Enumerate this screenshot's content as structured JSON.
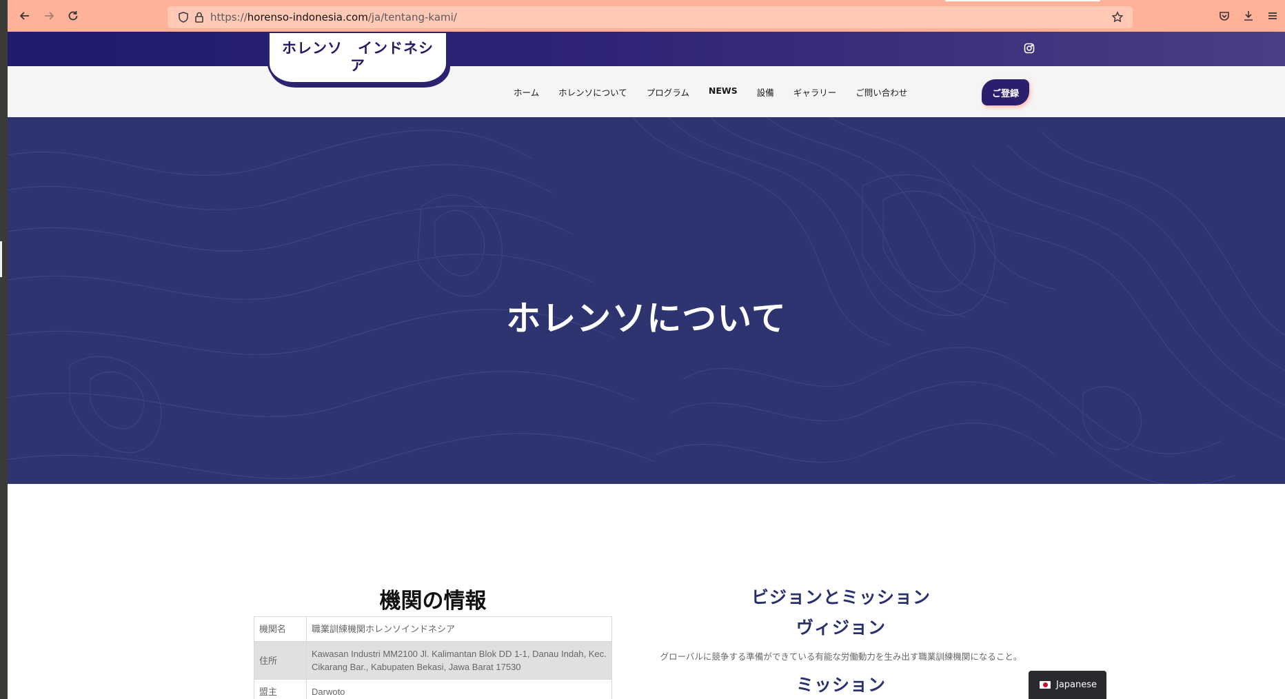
{
  "browser": {
    "url_scheme": "https://",
    "url_host": "horenso-indonesia.com",
    "url_path": "/ja/tentang-kami/"
  },
  "icons": {
    "back": "back-arrow-icon",
    "forward": "forward-arrow-icon",
    "reload": "reload-icon",
    "shield": "tracking-shield-icon",
    "lock": "lock-icon",
    "bookmark": "star-icon",
    "pocket": "pocket-icon",
    "downloads": "download-icon",
    "menu": "hamburger-menu-icon",
    "social": "instagram-icon"
  },
  "site": {
    "logo_text": "ホレンソ　インドネシア",
    "nav": [
      {
        "label": "ホーム"
      },
      {
        "label": "ホレンソについて"
      },
      {
        "label": "プログラム"
      },
      {
        "label": "NEWS"
      },
      {
        "label": "設備"
      },
      {
        "label": "ギャラリー"
      },
      {
        "label": "ご問い合わせ"
      }
    ],
    "register_label": "ご登録"
  },
  "hero": {
    "title": "ホレンソについて"
  },
  "info": {
    "title": "機関の情報",
    "rows": [
      {
        "key": "機関名",
        "value": "職業訓練機関ホレンソインドネシア"
      },
      {
        "key": "住所",
        "value": "Kawasan Industri MM2100 Jl. Kalimantan Blok DD 1-1, Danau Indah, Kec. Cikarang Bar., Kabupaten Bekasi, Jawa Barat 17530"
      },
      {
        "key": "盟主",
        "value": "Darwoto"
      }
    ]
  },
  "vision_mission": {
    "title": "ビジョンとミッション",
    "vision_title": "ヴィジョン",
    "vision_text": "グローバルに競争する準備ができている有能な労働動力を生み出す職業訓練機関になること。",
    "mission_title": "ミッション"
  },
  "language_switcher": {
    "label": "Japanese"
  },
  "colors": {
    "browser_toolbar": "#ffb297",
    "brand_navy": "#2a2f6e",
    "hero_bg": "#2d3470",
    "topbar_start": "#1f1b6d",
    "topbar_end": "#4a3e84"
  }
}
